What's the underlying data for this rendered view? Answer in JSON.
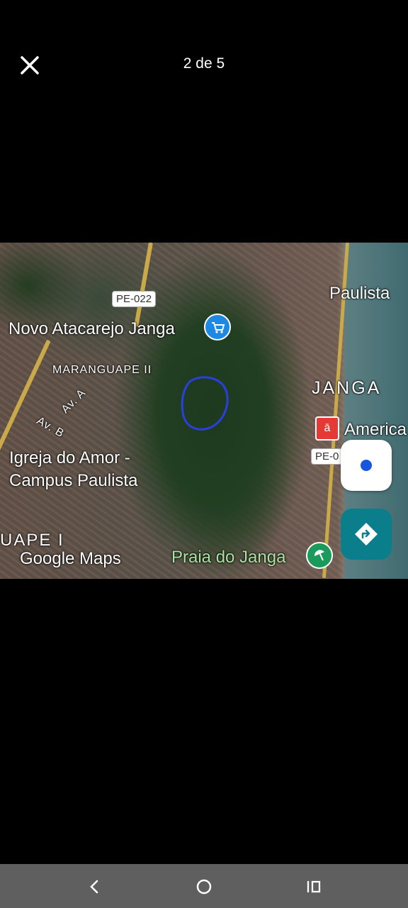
{
  "viewer": {
    "counter": "2 de 5"
  },
  "map": {
    "labels": {
      "paulista": "Paulista",
      "novo_atacarejo": "Novo Atacarejo Janga",
      "maranguape_ii": "MARANGUAPE II",
      "janga": "JANGA",
      "americanas": "America",
      "av_a": "Av. A",
      "av_b": "Av. B",
      "igreja_line1": "Igreja do Amor -",
      "igreja_line2": "Campus Paulista",
      "maranguape_i": "UAPE I",
      "praia": "Praia do Janga",
      "watermark": "Google Maps"
    },
    "road_signs": {
      "pe022": "PE-022",
      "pe0": "PE-0"
    },
    "icons": {
      "shop_pin": "shopping-cart-icon",
      "store_pin": "americanas-store-icon",
      "beach_pin": "beach-umbrella-icon",
      "locate": "my-location-icon",
      "directions": "directions-icon"
    },
    "colors": {
      "annotation_circle": "#2a3fe0",
      "directions_fab": "#0b7e8c",
      "locate_dot": "#1a56db"
    }
  },
  "system_nav": {
    "buttons": [
      "back-icon",
      "home-icon",
      "recents-icon"
    ]
  }
}
